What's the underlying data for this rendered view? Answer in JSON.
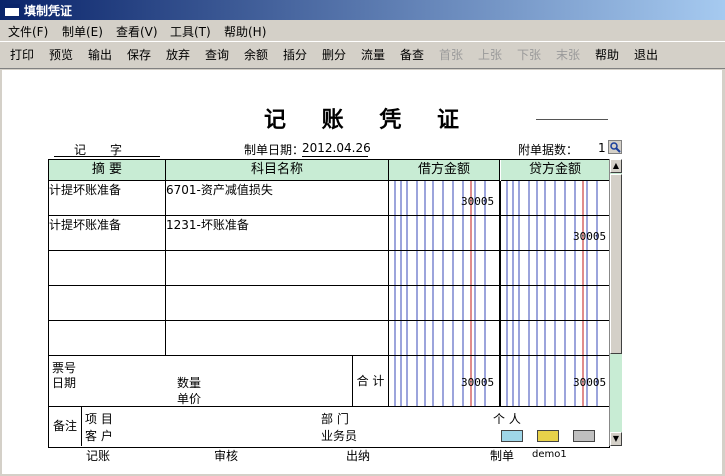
{
  "window": {
    "title": "填制凭证"
  },
  "menu": [
    "文件(F)",
    "制单(E)",
    "查看(V)",
    "工具(T)",
    "帮助(H)"
  ],
  "toolbar": [
    {
      "label": "打印",
      "enabled": true
    },
    {
      "label": "预览",
      "enabled": true
    },
    {
      "label": "输出",
      "enabled": true
    },
    {
      "label": "保存",
      "enabled": true
    },
    {
      "label": "放弃",
      "enabled": true
    },
    {
      "label": "查询",
      "enabled": true
    },
    {
      "label": "余额",
      "enabled": true
    },
    {
      "label": "插分",
      "enabled": true
    },
    {
      "label": "删分",
      "enabled": true
    },
    {
      "label": "流量",
      "enabled": true
    },
    {
      "label": "备查",
      "enabled": true
    },
    {
      "label": "首张",
      "enabled": false
    },
    {
      "label": "上张",
      "enabled": false
    },
    {
      "label": "下张",
      "enabled": false
    },
    {
      "label": "末张",
      "enabled": false
    },
    {
      "label": "帮助",
      "enabled": true
    },
    {
      "label": "退出",
      "enabled": true
    }
  ],
  "voucher": {
    "title": "记 账 凭 证",
    "type_label": "记",
    "word_label": "字",
    "date_label": "制单日期：",
    "date": "2012.04.26",
    "attach_label": "附单据数：",
    "attach_count": "1",
    "headers": {
      "summary": "摘 要",
      "account": "科目名称",
      "debit": "借方金额",
      "credit": "贷方金额"
    },
    "entries": [
      {
        "summary": "计提坏账准备",
        "account": "6701-资产减值损失",
        "debit": "30005",
        "credit": ""
      },
      {
        "summary": "计提坏账准备",
        "account": "1231-坏账准备",
        "debit": "",
        "credit": "30005"
      },
      {
        "summary": "",
        "account": "",
        "debit": "",
        "credit": ""
      },
      {
        "summary": "",
        "account": "",
        "debit": "",
        "credit": ""
      },
      {
        "summary": "",
        "account": "",
        "debit": "",
        "credit": ""
      }
    ],
    "ticket_no_label": "票号",
    "ticket_date_label": "日期",
    "qty_label": "数量",
    "price_label": "单价",
    "total_label": "合 计",
    "total_debit": "30005",
    "total_credit": "30005",
    "remark_label": "备注",
    "project_label": "项   目",
    "dept_label": "部   门",
    "person_label": "个   人",
    "customer_label": "客   户",
    "salesman_label": "业务员",
    "footer": {
      "bookkeep": "记账",
      "review": "审核",
      "cashier": "出纳",
      "maker_label": "制单",
      "maker": "demo1"
    }
  }
}
